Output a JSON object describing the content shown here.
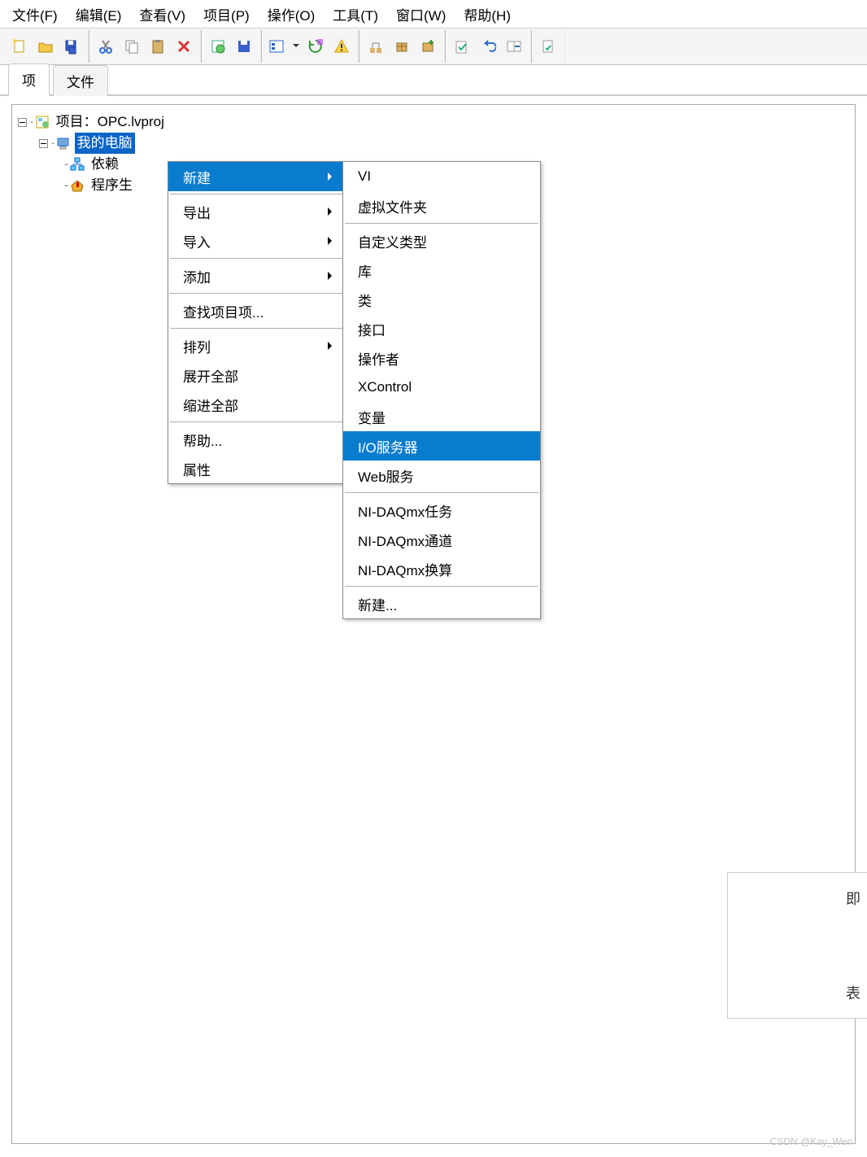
{
  "menubar": [
    {
      "id": "file",
      "label": "文件(F)"
    },
    {
      "id": "edit",
      "label": "编辑(E)"
    },
    {
      "id": "view",
      "label": "查看(V)"
    },
    {
      "id": "project",
      "label": "项目(P)"
    },
    {
      "id": "operate",
      "label": "操作(O)"
    },
    {
      "id": "tools",
      "label": "工具(T)"
    },
    {
      "id": "window",
      "label": "窗口(W)"
    },
    {
      "id": "help",
      "label": "帮助(H)"
    }
  ],
  "tabs": {
    "project": "项",
    "files": "文件"
  },
  "tree": {
    "root": {
      "label": "项目：OPC.lvproj"
    },
    "mypc": {
      "label": "我的电脑"
    },
    "deps": {
      "label": "依赖"
    },
    "build": {
      "label": "程序生"
    }
  },
  "context_menu": [
    {
      "label": "新建",
      "sub": true,
      "highlight": true
    },
    {
      "sep": true
    },
    {
      "label": "导出",
      "sub": true
    },
    {
      "label": "导入",
      "sub": true
    },
    {
      "sep": true
    },
    {
      "label": "添加",
      "sub": true
    },
    {
      "sep": true
    },
    {
      "label": "查找项目项..."
    },
    {
      "sep": true
    },
    {
      "label": "排列",
      "sub": true
    },
    {
      "label": "展开全部"
    },
    {
      "label": "缩进全部"
    },
    {
      "sep": true
    },
    {
      "label": "帮助..."
    },
    {
      "label": "属性"
    }
  ],
  "submenu": [
    {
      "label": "VI"
    },
    {
      "label": "虚拟文件夹"
    },
    {
      "sep": true
    },
    {
      "label": "自定义类型"
    },
    {
      "label": "库"
    },
    {
      "label": "类"
    },
    {
      "label": "接口"
    },
    {
      "label": "操作者"
    },
    {
      "label": "XControl"
    },
    {
      "label": "变量"
    },
    {
      "label": "I/O服务器",
      "highlight": true
    },
    {
      "label": "Web服务"
    },
    {
      "sep": true
    },
    {
      "label": "NI-DAQmx任务"
    },
    {
      "label": "NI-DAQmx通道"
    },
    {
      "label": "NI-DAQmx换算"
    },
    {
      "sep": true
    },
    {
      "label": "新建..."
    }
  ],
  "sidebox": {
    "top": "即",
    "bottom": "表"
  },
  "watermark": "CSDN @Kay_Wen"
}
